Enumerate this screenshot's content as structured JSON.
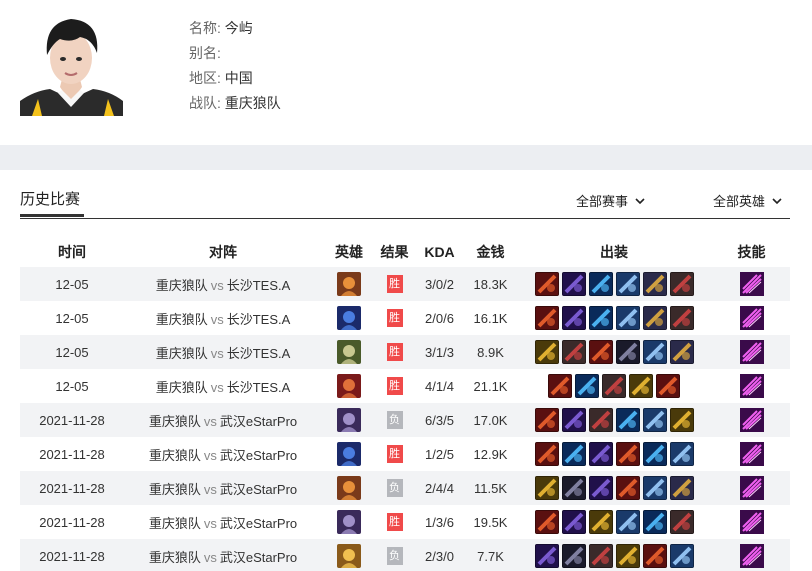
{
  "player": {
    "name_label": "名称:",
    "name": "今屿",
    "alias_label": "别名:",
    "alias": "",
    "region_label": "地区:",
    "region": "中国",
    "team_label": "战队:",
    "team": "重庆狼队"
  },
  "history": {
    "title": "历史比赛",
    "filter_events": "全部赛事",
    "filter_heroes": "全部英雄"
  },
  "table": {
    "headers": {
      "time": "时间",
      "match": "对阵",
      "hero": "英雄",
      "result": "结果",
      "kda": "KDA",
      "gold": "金钱",
      "equip": "出装",
      "skill": "技能"
    },
    "vs": "vs",
    "rows": [
      {
        "time": "12-05",
        "team_a": "重庆狼队",
        "team_b": "长沙TES.A",
        "hero_icon": "hero-orange-icon",
        "result": "胜",
        "kda": "3/0/2",
        "gold": "18.3K",
        "equip_count": 6
      },
      {
        "time": "12-05",
        "team_a": "重庆狼队",
        "team_b": "长沙TES.A",
        "hero_icon": "hero-blue-icon",
        "result": "胜",
        "kda": "2/0/6",
        "gold": "16.1K",
        "equip_count": 6
      },
      {
        "time": "12-05",
        "team_a": "重庆狼队",
        "team_b": "长沙TES.A",
        "hero_icon": "hero-green-icon",
        "result": "胜",
        "kda": "3/1/3",
        "gold": "8.9K",
        "equip_count": 6
      },
      {
        "time": "12-05",
        "team_a": "重庆狼队",
        "team_b": "长沙TES.A",
        "hero_icon": "hero-red-icon",
        "result": "胜",
        "kda": "4/1/4",
        "gold": "21.1K",
        "equip_count": 5
      },
      {
        "time": "2021-11-28",
        "team_a": "重庆狼队",
        "team_b": "武汉eStarPro",
        "hero_icon": "hero-purple-icon",
        "result": "负",
        "kda": "6/3/5",
        "gold": "17.0K",
        "equip_count": 6
      },
      {
        "time": "2021-11-28",
        "team_a": "重庆狼队",
        "team_b": "武汉eStarPro",
        "hero_icon": "hero-blue-icon",
        "result": "胜",
        "kda": "1/2/5",
        "gold": "12.9K",
        "equip_count": 6
      },
      {
        "time": "2021-11-28",
        "team_a": "重庆狼队",
        "team_b": "武汉eStarPro",
        "hero_icon": "hero-orange-icon",
        "result": "负",
        "kda": "2/4/4",
        "gold": "11.5K",
        "equip_count": 6
      },
      {
        "time": "2021-11-28",
        "team_a": "重庆狼队",
        "team_b": "武汉eStarPro",
        "hero_icon": "hero-purple-icon",
        "result": "胜",
        "kda": "1/3/6",
        "gold": "19.5K",
        "equip_count": 6
      },
      {
        "time": "2021-11-28",
        "team_a": "重庆狼队",
        "team_b": "武汉eStarPro",
        "hero_icon": "hero-gold-icon",
        "result": "负",
        "kda": "2/3/0",
        "gold": "7.7K",
        "equip_count": 6
      }
    ]
  },
  "colors": {
    "win": "#f04a4a",
    "lose": "#b5b7bc",
    "band": "#eceef2",
    "row_alt": "#f2f3f5"
  }
}
